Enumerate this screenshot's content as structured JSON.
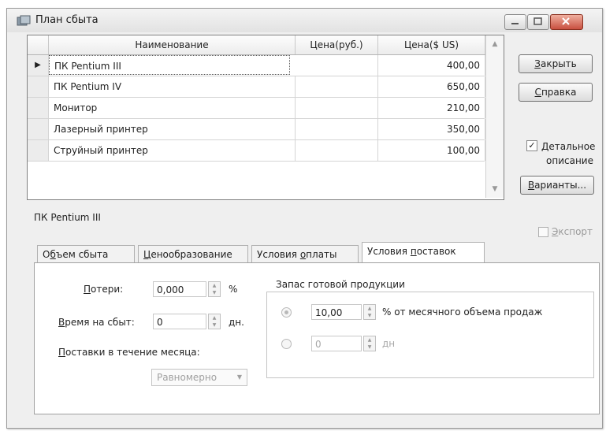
{
  "window": {
    "title": "План сбыта"
  },
  "grid": {
    "columns": [
      "Наименование",
      "Цена(руб.)",
      "Цена($ US)"
    ],
    "rows": [
      {
        "name": "ПК Pentium III",
        "price_rub": "",
        "price_usd": "400,00",
        "selected": true
      },
      {
        "name": "ПК Pentium IV",
        "price_rub": "",
        "price_usd": "650,00"
      },
      {
        "name": "Монитор",
        "price_rub": "",
        "price_usd": "210,00"
      },
      {
        "name": "Лазерный принтер",
        "price_rub": "",
        "price_usd": "350,00"
      },
      {
        "name": "Струйный принтер",
        "price_rub": "",
        "price_usd": "100,00"
      }
    ]
  },
  "buttons": {
    "close": {
      "hotkey": "З",
      "rest": "акрыть"
    },
    "help": {
      "hotkey": "С",
      "rest": "правка"
    },
    "variants": {
      "hotkey": "В",
      "rest": "арианты..."
    }
  },
  "detail_checkbox": {
    "hotkey": "Д",
    "rest": "етальное",
    "line2": "описание",
    "checked": true
  },
  "export_checkbox": {
    "hotkey": "Э",
    "rest": "кспорт",
    "checked": false,
    "enabled": false
  },
  "selected_item_caption": "ПК Pentium III",
  "tabs": [
    {
      "pre": "О",
      "hotkey": "б",
      "post": "ъем сбыта"
    },
    {
      "pre": "",
      "hotkey": "Ц",
      "post": "енообразование"
    },
    {
      "pre": "Условия ",
      "hotkey": "о",
      "post": "платы"
    },
    {
      "pre": "Условия ",
      "hotkey": "п",
      "post": "оставок",
      "active": true
    }
  ],
  "form": {
    "losses": {
      "hotkey": "П",
      "rest": "отери:",
      "value": "0,000",
      "unit": "%"
    },
    "sell_time": {
      "hotkey": "В",
      "rest": "ремя на сбыт:",
      "value": "0",
      "unit": "дн."
    },
    "deliveries": {
      "hotkey": "П",
      "rest": "оставки в течение месяца:",
      "option": "Равномерно"
    },
    "stock": {
      "title": "Запас готовой продукции",
      "percent_value": "10,00",
      "percent_unit": "% от месячного объема продаж",
      "days_value": "0",
      "days_unit": "дн"
    }
  },
  "colors": {
    "window_bg": "#efefef",
    "close_button": "#c85040",
    "panel_bg": "#ffffff"
  }
}
